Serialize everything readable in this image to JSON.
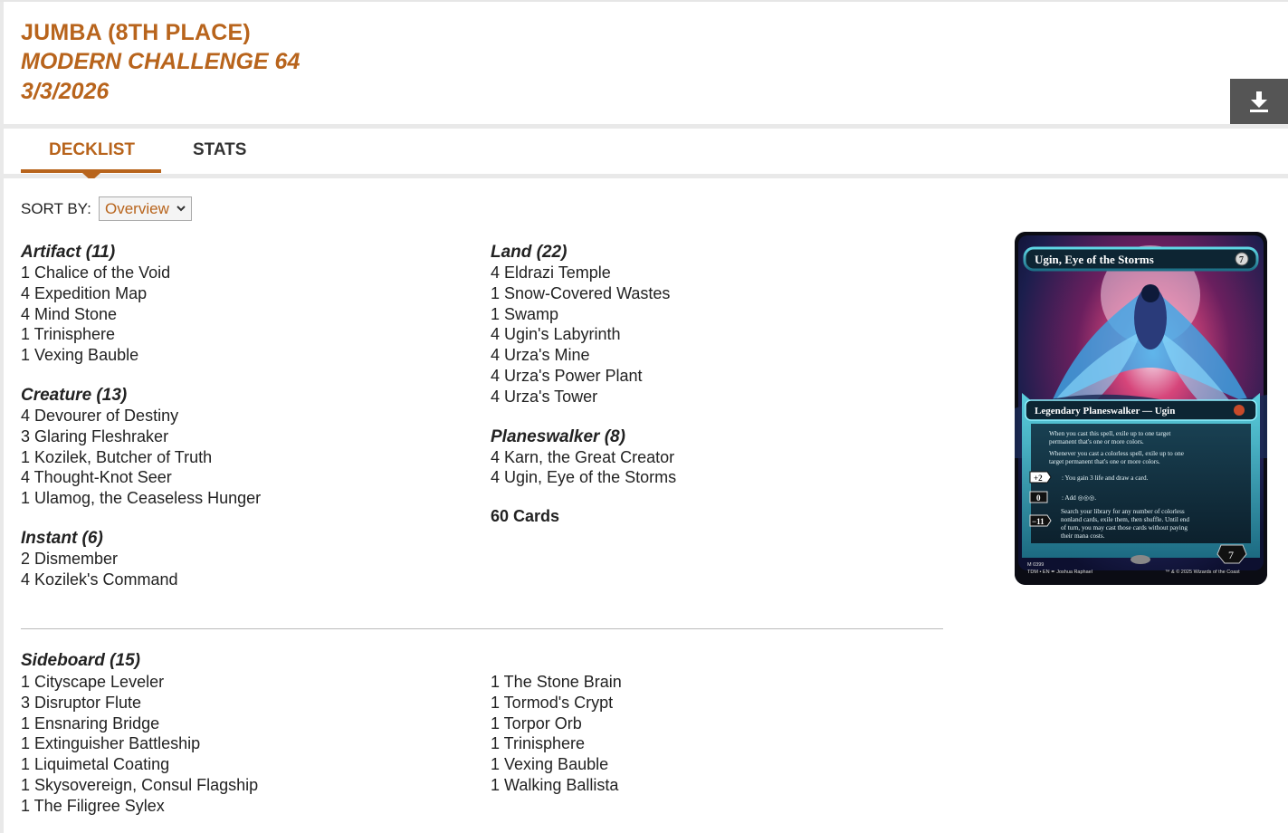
{
  "header": {
    "player": "JUMBA (8TH PLACE)",
    "event": "MODERN CHALLENGE 64",
    "date": "3/3/2026"
  },
  "tabs": [
    {
      "label": "DECKLIST",
      "active": true
    },
    {
      "label": "STATS",
      "active": false
    }
  ],
  "sort": {
    "label": "SORT BY:",
    "value": "Overview"
  },
  "left_groups": [
    {
      "title": "Artifact (11)",
      "cards": [
        "1 Chalice of the Void",
        "4 Expedition Map",
        "4 Mind Stone",
        "1 Trinisphere",
        "1 Vexing Bauble"
      ]
    },
    {
      "title": "Creature (13)",
      "cards": [
        "4 Devourer of Destiny",
        "3 Glaring Fleshraker",
        "1 Kozilek, Butcher of Truth",
        "4 Thought-Knot Seer",
        "1 Ulamog, the Ceaseless Hunger"
      ]
    },
    {
      "title": "Instant (6)",
      "cards": [
        "2 Dismember",
        "4 Kozilek's Command"
      ]
    }
  ],
  "right_groups": [
    {
      "title": "Land (22)",
      "cards": [
        "4 Eldrazi Temple",
        "1 Snow-Covered Wastes",
        "1 Swamp",
        "4 Ugin's Labyrinth",
        "4 Urza's Mine",
        "4 Urza's Power Plant",
        "4 Urza's Tower"
      ]
    },
    {
      "title": "Planeswalker (8)",
      "cards": [
        "4 Karn, the Great Creator",
        "4 Ugin, Eye of the Storms"
      ]
    }
  ],
  "total": "60 Cards",
  "sideboard": {
    "title": "Sideboard (15)",
    "left": [
      "1 Cityscape Leveler",
      "3 Disruptor Flute",
      "1 Ensnaring Bridge",
      "1 Extinguisher Battleship",
      "1 Liquimetal Coating",
      "1 Skysovereign, Consul Flagship",
      "1 The Filigree Sylex"
    ],
    "right": [
      "1 The Stone Brain",
      "1 Tormod's Crypt",
      "1 Torpor Orb",
      "1 Trinisphere",
      "1 Vexing Bauble",
      "1 Walking Ballista"
    ]
  },
  "card_preview": {
    "name": "Ugin, Eye of the Storms",
    "cost": "7",
    "type_line": "Legendary Planeswalker — Ugin",
    "static_text_1": "When you cast this spell, exile up to one target permanent that's one or more colors.",
    "static_text_2": "Whenever you cast a colorless spell, exile up to one target permanent that's one or more colors.",
    "ability_1_cost": "+2",
    "ability_1_text": ": You gain 3 life and draw a card.",
    "ability_2_cost": "0",
    "ability_2_text": ": Add ◎◎◎.",
    "ability_3_cost": "−11",
    "ability_3_text": "Search your library for any number of colorless nonland cards, exile them, then shuffle. Until end of turn, you may cast those cards without paying their mana costs.",
    "loyalty": "7",
    "collector_line": "M 0399",
    "set_line": "TDM • EN ✒ Joshua Raphael",
    "copyright": "™ & © 2025 Wizards of the Coast"
  },
  "colors": {
    "accent": "#b8641c",
    "download_bg": "#555555"
  },
  "icons": {
    "download": "download-icon",
    "dropdown": "chevron-down-icon"
  }
}
